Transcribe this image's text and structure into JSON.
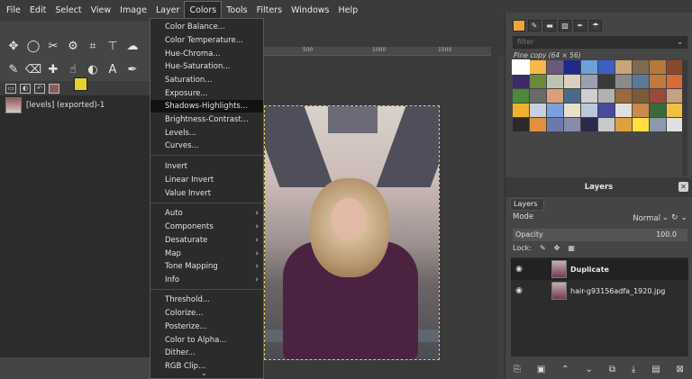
{
  "menubar": {
    "items": [
      "File",
      "Edit",
      "Select",
      "View",
      "Image",
      "Layer",
      "Colors",
      "Tools",
      "Filters",
      "Windows",
      "Help"
    ],
    "active": "Colors"
  },
  "colors_menu": {
    "group1": [
      "Color Balance...",
      "Color Temperature...",
      "Hue-Chroma...",
      "Hue-Saturation...",
      "Saturation...",
      "Exposure...",
      "Shadows-Highlights...",
      "Brightness-Contrast...",
      "Levels...",
      "Curves..."
    ],
    "highlighted": "Shadows-Highlights...",
    "group2": [
      "Invert",
      "Linear Invert",
      "Value Invert"
    ],
    "group3": [
      "Auto",
      "Components",
      "Desaturate",
      "Map",
      "Tone Mapping",
      "Info"
    ],
    "group4": [
      "Threshold...",
      "Colorize...",
      "Posterize...",
      "Color to Alpha...",
      "Dither...",
      "RGB Clip..."
    ],
    "submenu_arrow": "›",
    "scroll_down_icon": "⌄"
  },
  "toolbox": {
    "tools": [
      "move-icon",
      "ellipse-select-icon",
      "scissors-icon",
      "fuzzy-select-icon",
      "crop-icon",
      "transform-icon",
      "warp-icon",
      "paintbrush-icon",
      "eraser-icon",
      "heal-icon",
      "smudge-icon",
      "dodge-icon",
      "text-icon",
      "color-picker-icon"
    ],
    "fg_color": "#e9d12b",
    "bg_color": "#ffffff"
  },
  "images_panel": {
    "item_label": "[levels] (exported)-1"
  },
  "ruler": {
    "marks": [
      "500",
      "1000",
      "1500"
    ]
  },
  "right_panel": {
    "filter_placeholder": "filter",
    "pattern_title": "Pine copy (64 × 56)",
    "layers_title": "Layers",
    "tab_label": "Layers",
    "mode_label": "Mode",
    "mode_value": "Normal",
    "opacity_label": "Opacity",
    "opacity_value": "100.0",
    "lock_label": "Lock:",
    "layers": [
      {
        "name": "Duplicate",
        "selected": true
      },
      {
        "name": "hair-g93156adfa_1920.jpg",
        "selected": false
      }
    ]
  },
  "pattern_colors": [
    "#ffffff",
    "#f7b84a",
    "#6b5a7a",
    "#1f2a8a",
    "#6fa0d8",
    "#3b5fc4",
    "#c9a57a",
    "#7e6a4e",
    "#b57a3a",
    "#8a4a2a",
    "#3a2a6a",
    "#6a8a3a",
    "#c2c2b2",
    "#d9d0c0",
    "#9aa0b0",
    "#3a3a3a",
    "#8a8a8a",
    "#5a7a9a",
    "#c27a3a",
    "#d86a3a",
    "#4a8a3a",
    "#6a6a6a",
    "#d9a07a",
    "#4a6a8a",
    "#cfcfcf",
    "#b2b2b2",
    "#9a6a3a",
    "#7a5a3a",
    "#9a4a3a",
    "#c9a080",
    "#f0b030",
    "#c8d0e0",
    "#7aa0e0",
    "#e9e0c9",
    "#b9c9d9",
    "#4a4a9a",
    "#e0e0e0",
    "#c98a4a",
    "#3a6a3a",
    "#f0c040",
    "#2a2a2a",
    "#e09040",
    "#6a7aaa",
    "#8a8aaa",
    "#2a2a4a",
    "#c9c9c9",
    "#e0a040",
    "#ffe040",
    "#8a9aaa",
    "#e0e0e0"
  ]
}
